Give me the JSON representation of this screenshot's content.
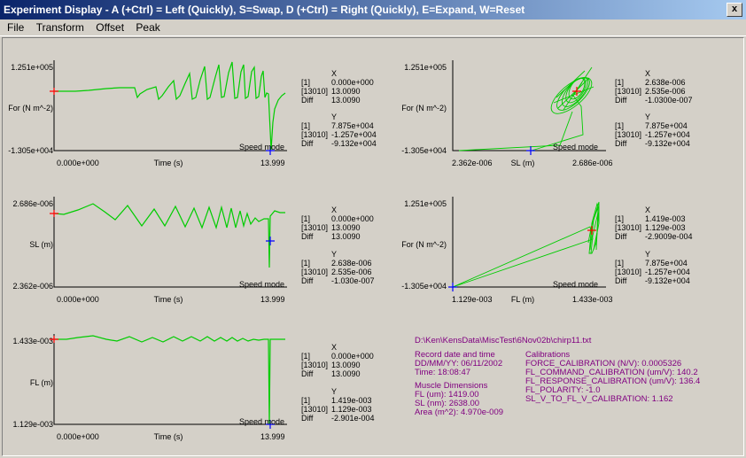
{
  "window": {
    "title": "Experiment Display - A (+Ctrl) = Left (Quickly), S=Swap, D (+Ctrl) = Right (Quickly), E=Expand, W=Reset",
    "close_glyph": "x"
  },
  "menu": [
    "File",
    "Transform",
    "Offset",
    "Peak"
  ],
  "colors": {
    "trace": "#00cc00",
    "cursor_start": "#ff0000",
    "cursor_end": "#0000ff",
    "info_text": "#800080"
  },
  "cursor_table": {
    "x_header": "X",
    "y_header": "Y",
    "row_labels": [
      "[1]",
      "[13010]",
      "Diff"
    ]
  },
  "plots": {
    "force_time": {
      "y_top": "1.251e+005",
      "y_bottom": "-1.305e+004",
      "y_label": "For (N m^-2)",
      "x_left": "0.000e+000",
      "x_right": "13.999",
      "x_label": "Time (s)",
      "mode": "Speed mode",
      "x_values": [
        "0.000e+000",
        "13.0090",
        "13.0090"
      ],
      "y_values": [
        "7.875e+004",
        "-1.257e+004",
        "-9.132e+004"
      ]
    },
    "sl_time": {
      "y_top": "2.686e-006",
      "y_bottom": "2.362e-006",
      "y_label": "SL (m)",
      "x_left": "0.000e+000",
      "x_right": "13.999",
      "x_label": "Time (s)",
      "mode": "Speed mode",
      "x_values": [
        "0.000e+000",
        "13.0090",
        "13.0090"
      ],
      "y_values": [
        "2.638e-006",
        "2.535e-006",
        "-1.030e-007"
      ]
    },
    "fl_time": {
      "y_top": "1.433e-003",
      "y_bottom": "1.129e-003",
      "y_label": "FL (m)",
      "x_left": "0.000e+000",
      "x_right": "13.999",
      "x_label": "Time (s)",
      "mode": "Speed mode",
      "x_values": [
        "0.000e+000",
        "13.0090",
        "13.0090"
      ],
      "y_values": [
        "1.419e-003",
        "1.129e-003",
        "-2.901e-004"
      ]
    },
    "force_sl": {
      "y_top": "1.251e+005",
      "y_bottom": "-1.305e+004",
      "y_label": "For (N m^-2)",
      "x_left": "2.362e-006",
      "x_right": "2.686e-006",
      "x_label": "SL (m)",
      "mode": "Speed mode",
      "x_values": [
        "2.638e-006",
        "2.535e-006",
        "-1.0300e-007"
      ],
      "y_values": [
        "7.875e+004",
        "-1.257e+004",
        "-9.132e+004"
      ]
    },
    "force_fl": {
      "y_top": "1.251e+005",
      "y_bottom": "-1.305e+004",
      "y_label": "For (N m^-2)",
      "x_left": "1.129e-003",
      "x_right": "1.433e-003",
      "x_label": "FL (m)",
      "mode": "Speed mode",
      "x_values": [
        "1.419e-003",
        "1.129e-003",
        "-2.9009e-004"
      ],
      "y_values": [
        "7.875e+004",
        "-1.257e+004",
        "-9.132e+004"
      ]
    }
  },
  "info": {
    "file_path": "D:\\Ken\\KensData\\MiscTest\\6Nov02b\\chirp11.txt",
    "record_heading": "Record date and time",
    "date_line": "DD/MM/YY: 06/11/2002",
    "time_line": "Time: 18:08:47",
    "muscle_heading": "Muscle Dimensions",
    "fl_line": "FL (um): 1419.00",
    "sl_line": "SL (nm): 2638.00",
    "area_line": "Area (m^2): 4.970e-009",
    "cal_heading": "Calibrations",
    "cal_lines": [
      "FORCE_CALIBRATION (N/V): 0.0005326",
      "FL_COMMAND_CALIBRATION (um/V):  140.2",
      "FL_RESPONSE_CALIBRATION (um/V):  136.4",
      "FL_POLARITY: -1.0",
      "SL_V_TO_FL_V_CALIBRATION:  1.162"
    ]
  }
}
